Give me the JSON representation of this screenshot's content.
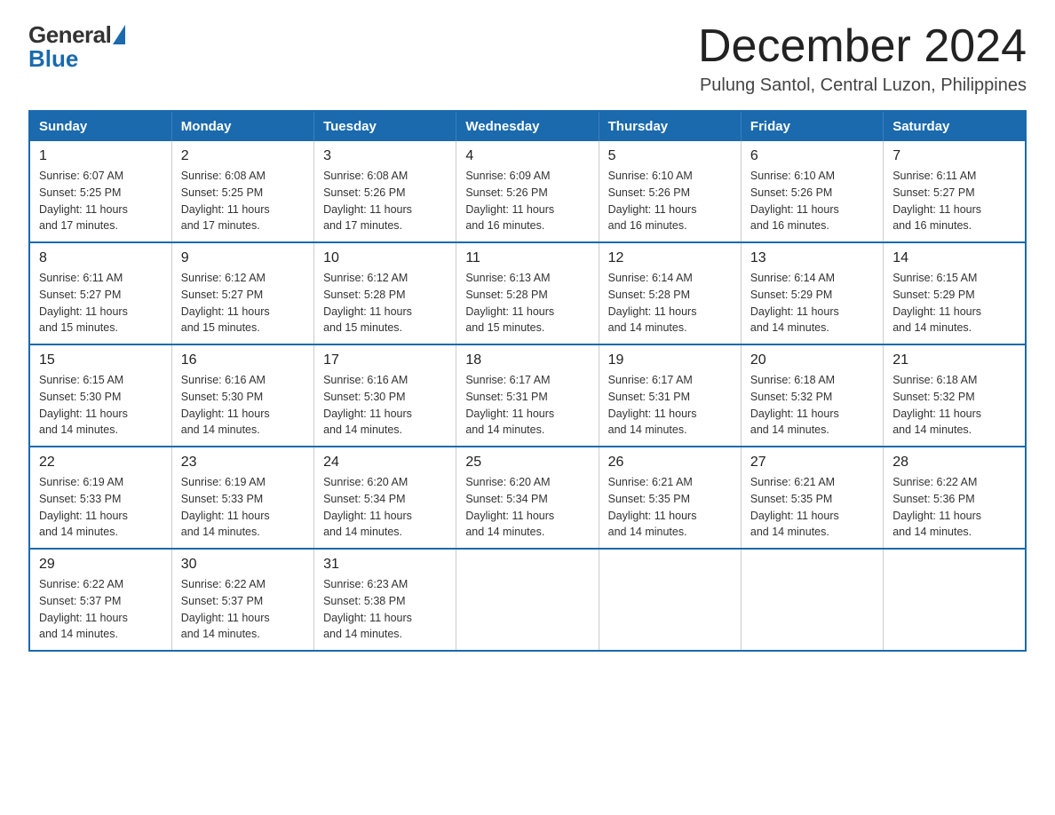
{
  "logo": {
    "general": "General",
    "blue": "Blue"
  },
  "header": {
    "month": "December 2024",
    "location": "Pulung Santol, Central Luzon, Philippines"
  },
  "weekdays": [
    "Sunday",
    "Monday",
    "Tuesday",
    "Wednesday",
    "Thursday",
    "Friday",
    "Saturday"
  ],
  "weeks": [
    [
      {
        "day": "1",
        "sunrise": "6:07 AM",
        "sunset": "5:25 PM",
        "daylight": "11 hours and 17 minutes."
      },
      {
        "day": "2",
        "sunrise": "6:08 AM",
        "sunset": "5:25 PM",
        "daylight": "11 hours and 17 minutes."
      },
      {
        "day": "3",
        "sunrise": "6:08 AM",
        "sunset": "5:26 PM",
        "daylight": "11 hours and 17 minutes."
      },
      {
        "day": "4",
        "sunrise": "6:09 AM",
        "sunset": "5:26 PM",
        "daylight": "11 hours and 16 minutes."
      },
      {
        "day": "5",
        "sunrise": "6:10 AM",
        "sunset": "5:26 PM",
        "daylight": "11 hours and 16 minutes."
      },
      {
        "day": "6",
        "sunrise": "6:10 AM",
        "sunset": "5:26 PM",
        "daylight": "11 hours and 16 minutes."
      },
      {
        "day": "7",
        "sunrise": "6:11 AM",
        "sunset": "5:27 PM",
        "daylight": "11 hours and 16 minutes."
      }
    ],
    [
      {
        "day": "8",
        "sunrise": "6:11 AM",
        "sunset": "5:27 PM",
        "daylight": "11 hours and 15 minutes."
      },
      {
        "day": "9",
        "sunrise": "6:12 AM",
        "sunset": "5:27 PM",
        "daylight": "11 hours and 15 minutes."
      },
      {
        "day": "10",
        "sunrise": "6:12 AM",
        "sunset": "5:28 PM",
        "daylight": "11 hours and 15 minutes."
      },
      {
        "day": "11",
        "sunrise": "6:13 AM",
        "sunset": "5:28 PM",
        "daylight": "11 hours and 15 minutes."
      },
      {
        "day": "12",
        "sunrise": "6:14 AM",
        "sunset": "5:28 PM",
        "daylight": "11 hours and 14 minutes."
      },
      {
        "day": "13",
        "sunrise": "6:14 AM",
        "sunset": "5:29 PM",
        "daylight": "11 hours and 14 minutes."
      },
      {
        "day": "14",
        "sunrise": "6:15 AM",
        "sunset": "5:29 PM",
        "daylight": "11 hours and 14 minutes."
      }
    ],
    [
      {
        "day": "15",
        "sunrise": "6:15 AM",
        "sunset": "5:30 PM",
        "daylight": "11 hours and 14 minutes."
      },
      {
        "day": "16",
        "sunrise": "6:16 AM",
        "sunset": "5:30 PM",
        "daylight": "11 hours and 14 minutes."
      },
      {
        "day": "17",
        "sunrise": "6:16 AM",
        "sunset": "5:30 PM",
        "daylight": "11 hours and 14 minutes."
      },
      {
        "day": "18",
        "sunrise": "6:17 AM",
        "sunset": "5:31 PM",
        "daylight": "11 hours and 14 minutes."
      },
      {
        "day": "19",
        "sunrise": "6:17 AM",
        "sunset": "5:31 PM",
        "daylight": "11 hours and 14 minutes."
      },
      {
        "day": "20",
        "sunrise": "6:18 AM",
        "sunset": "5:32 PM",
        "daylight": "11 hours and 14 minutes."
      },
      {
        "day": "21",
        "sunrise": "6:18 AM",
        "sunset": "5:32 PM",
        "daylight": "11 hours and 14 minutes."
      }
    ],
    [
      {
        "day": "22",
        "sunrise": "6:19 AM",
        "sunset": "5:33 PM",
        "daylight": "11 hours and 14 minutes."
      },
      {
        "day": "23",
        "sunrise": "6:19 AM",
        "sunset": "5:33 PM",
        "daylight": "11 hours and 14 minutes."
      },
      {
        "day": "24",
        "sunrise": "6:20 AM",
        "sunset": "5:34 PM",
        "daylight": "11 hours and 14 minutes."
      },
      {
        "day": "25",
        "sunrise": "6:20 AM",
        "sunset": "5:34 PM",
        "daylight": "11 hours and 14 minutes."
      },
      {
        "day": "26",
        "sunrise": "6:21 AM",
        "sunset": "5:35 PM",
        "daylight": "11 hours and 14 minutes."
      },
      {
        "day": "27",
        "sunrise": "6:21 AM",
        "sunset": "5:35 PM",
        "daylight": "11 hours and 14 minutes."
      },
      {
        "day": "28",
        "sunrise": "6:22 AM",
        "sunset": "5:36 PM",
        "daylight": "11 hours and 14 minutes."
      }
    ],
    [
      {
        "day": "29",
        "sunrise": "6:22 AM",
        "sunset": "5:37 PM",
        "daylight": "11 hours and 14 minutes."
      },
      {
        "day": "30",
        "sunrise": "6:22 AM",
        "sunset": "5:37 PM",
        "daylight": "11 hours and 14 minutes."
      },
      {
        "day": "31",
        "sunrise": "6:23 AM",
        "sunset": "5:38 PM",
        "daylight": "11 hours and 14 minutes."
      },
      null,
      null,
      null,
      null
    ]
  ],
  "labels": {
    "sunrise": "Sunrise:",
    "sunset": "Sunset:",
    "daylight": "Daylight:"
  }
}
